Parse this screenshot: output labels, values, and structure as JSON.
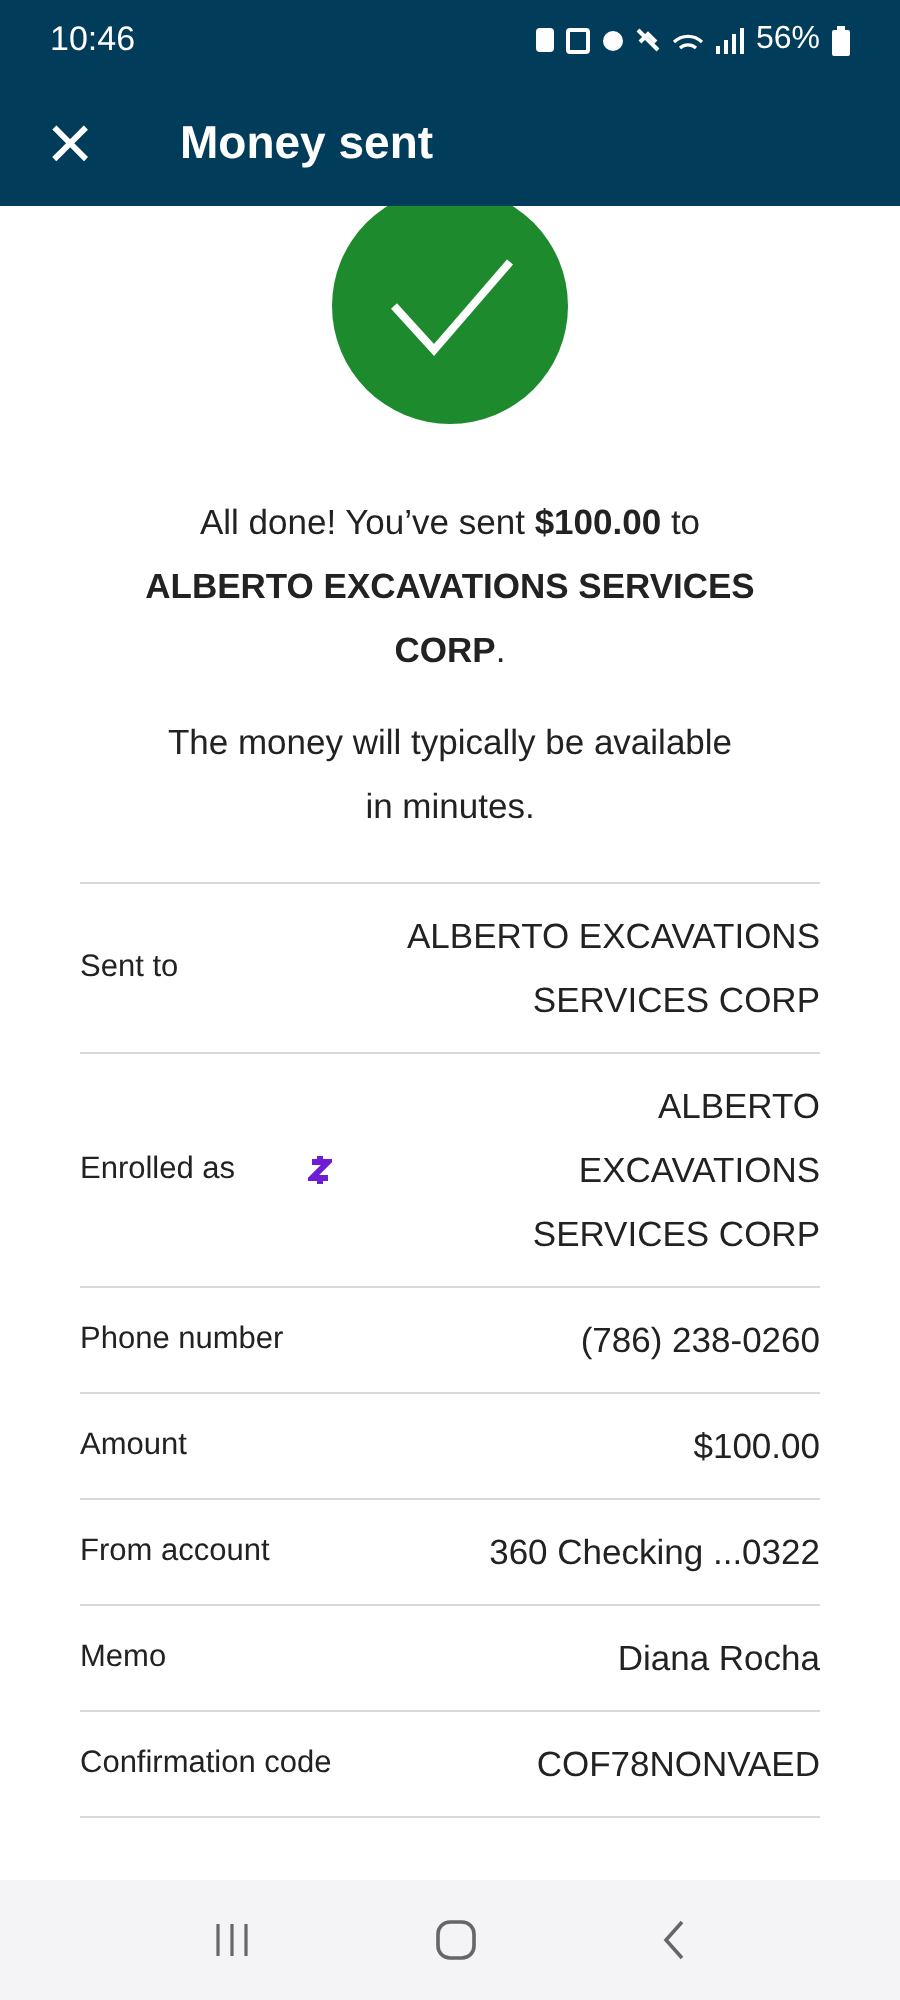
{
  "status_bar": {
    "time": "10:46",
    "battery": "56%"
  },
  "header": {
    "close": "×",
    "title": "Money sent"
  },
  "message": "All done! You’ve sent **$100.00** to **ALBERTO EXCAVATIONS SERVICES CORP**.",
  "note": "The money will typically be available in minutes.",
  "details": [
    {
      "kind": "plain",
      "label": "Sent to",
      "value": "ALBERTO EXCAVATIONS SERVICES CORP"
    },
    {
      "kind": "zelle",
      "label": "Enrolled as",
      "value": "ALBERTO EXCAVATIONS SERVICES CORP"
    },
    {
      "kind": "plain",
      "label": "Phone number",
      "value": "(786) 238-0260"
    },
    {
      "kind": "plain",
      "label": "Amount",
      "value": "$100.00"
    },
    {
      "kind": "plain",
      "label": "From account",
      "value": "360 Checking ...0322"
    },
    {
      "kind": "plain",
      "label": "Memo",
      "value": "Diana Rocha"
    },
    {
      "kind": "plain",
      "label": "Confirmation code",
      "value": "COF78NONVAED"
    }
  ]
}
